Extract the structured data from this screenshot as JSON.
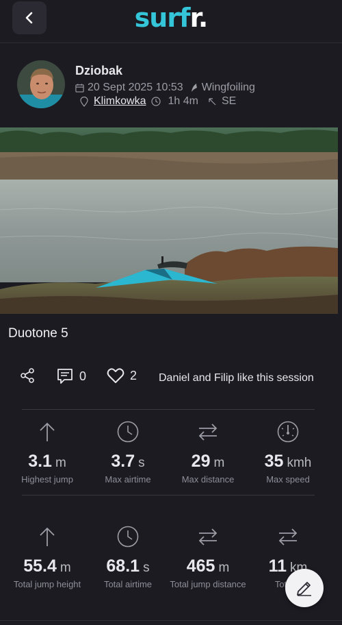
{
  "header": {
    "back_icon": "chevron-left-icon",
    "logo_part1": "surf",
    "logo_part2": "r."
  },
  "user": {
    "name": "Dziobak",
    "date": "20 Sept 2025 10:53",
    "sport": "Wingfoiling",
    "location": "Klimkowka",
    "duration": "1h 4m",
    "wind_direction": "SE"
  },
  "session": {
    "title": "Duotone 5",
    "comments_count": "0",
    "likes_count": "2",
    "likes_text": "Daniel and Filip like this session"
  },
  "stats_row1": [
    {
      "value": "3.1",
      "unit": "m",
      "label": "Highest jump",
      "icon": "arrow-up-icon"
    },
    {
      "value": "3.7",
      "unit": "s",
      "label": "Max airtime",
      "icon": "clock-icon"
    },
    {
      "value": "29",
      "unit": "m",
      "label": "Max distance",
      "icon": "arrows-swap-icon"
    },
    {
      "value": "35",
      "unit": "kmh",
      "label": "Max speed",
      "icon": "speedometer-icon"
    }
  ],
  "stats_row2": [
    {
      "value": "55.4",
      "unit": "m",
      "label": "Total jump height",
      "icon": "arrow-up-icon"
    },
    {
      "value": "68.1",
      "unit": "s",
      "label": "Total airtime",
      "icon": "clock-icon"
    },
    {
      "value": "465",
      "unit": "m",
      "label": "Total jump distance",
      "icon": "arrows-swap-icon"
    },
    {
      "value": "11",
      "unit": "km",
      "label": "Total d",
      "icon": "arrows-swap-icon"
    }
  ],
  "fab": {
    "icon": "edit-icon"
  },
  "colors": {
    "background": "#1c1b22",
    "logo_accent": "#34c5d9",
    "muted_text": "#9d9da6"
  }
}
